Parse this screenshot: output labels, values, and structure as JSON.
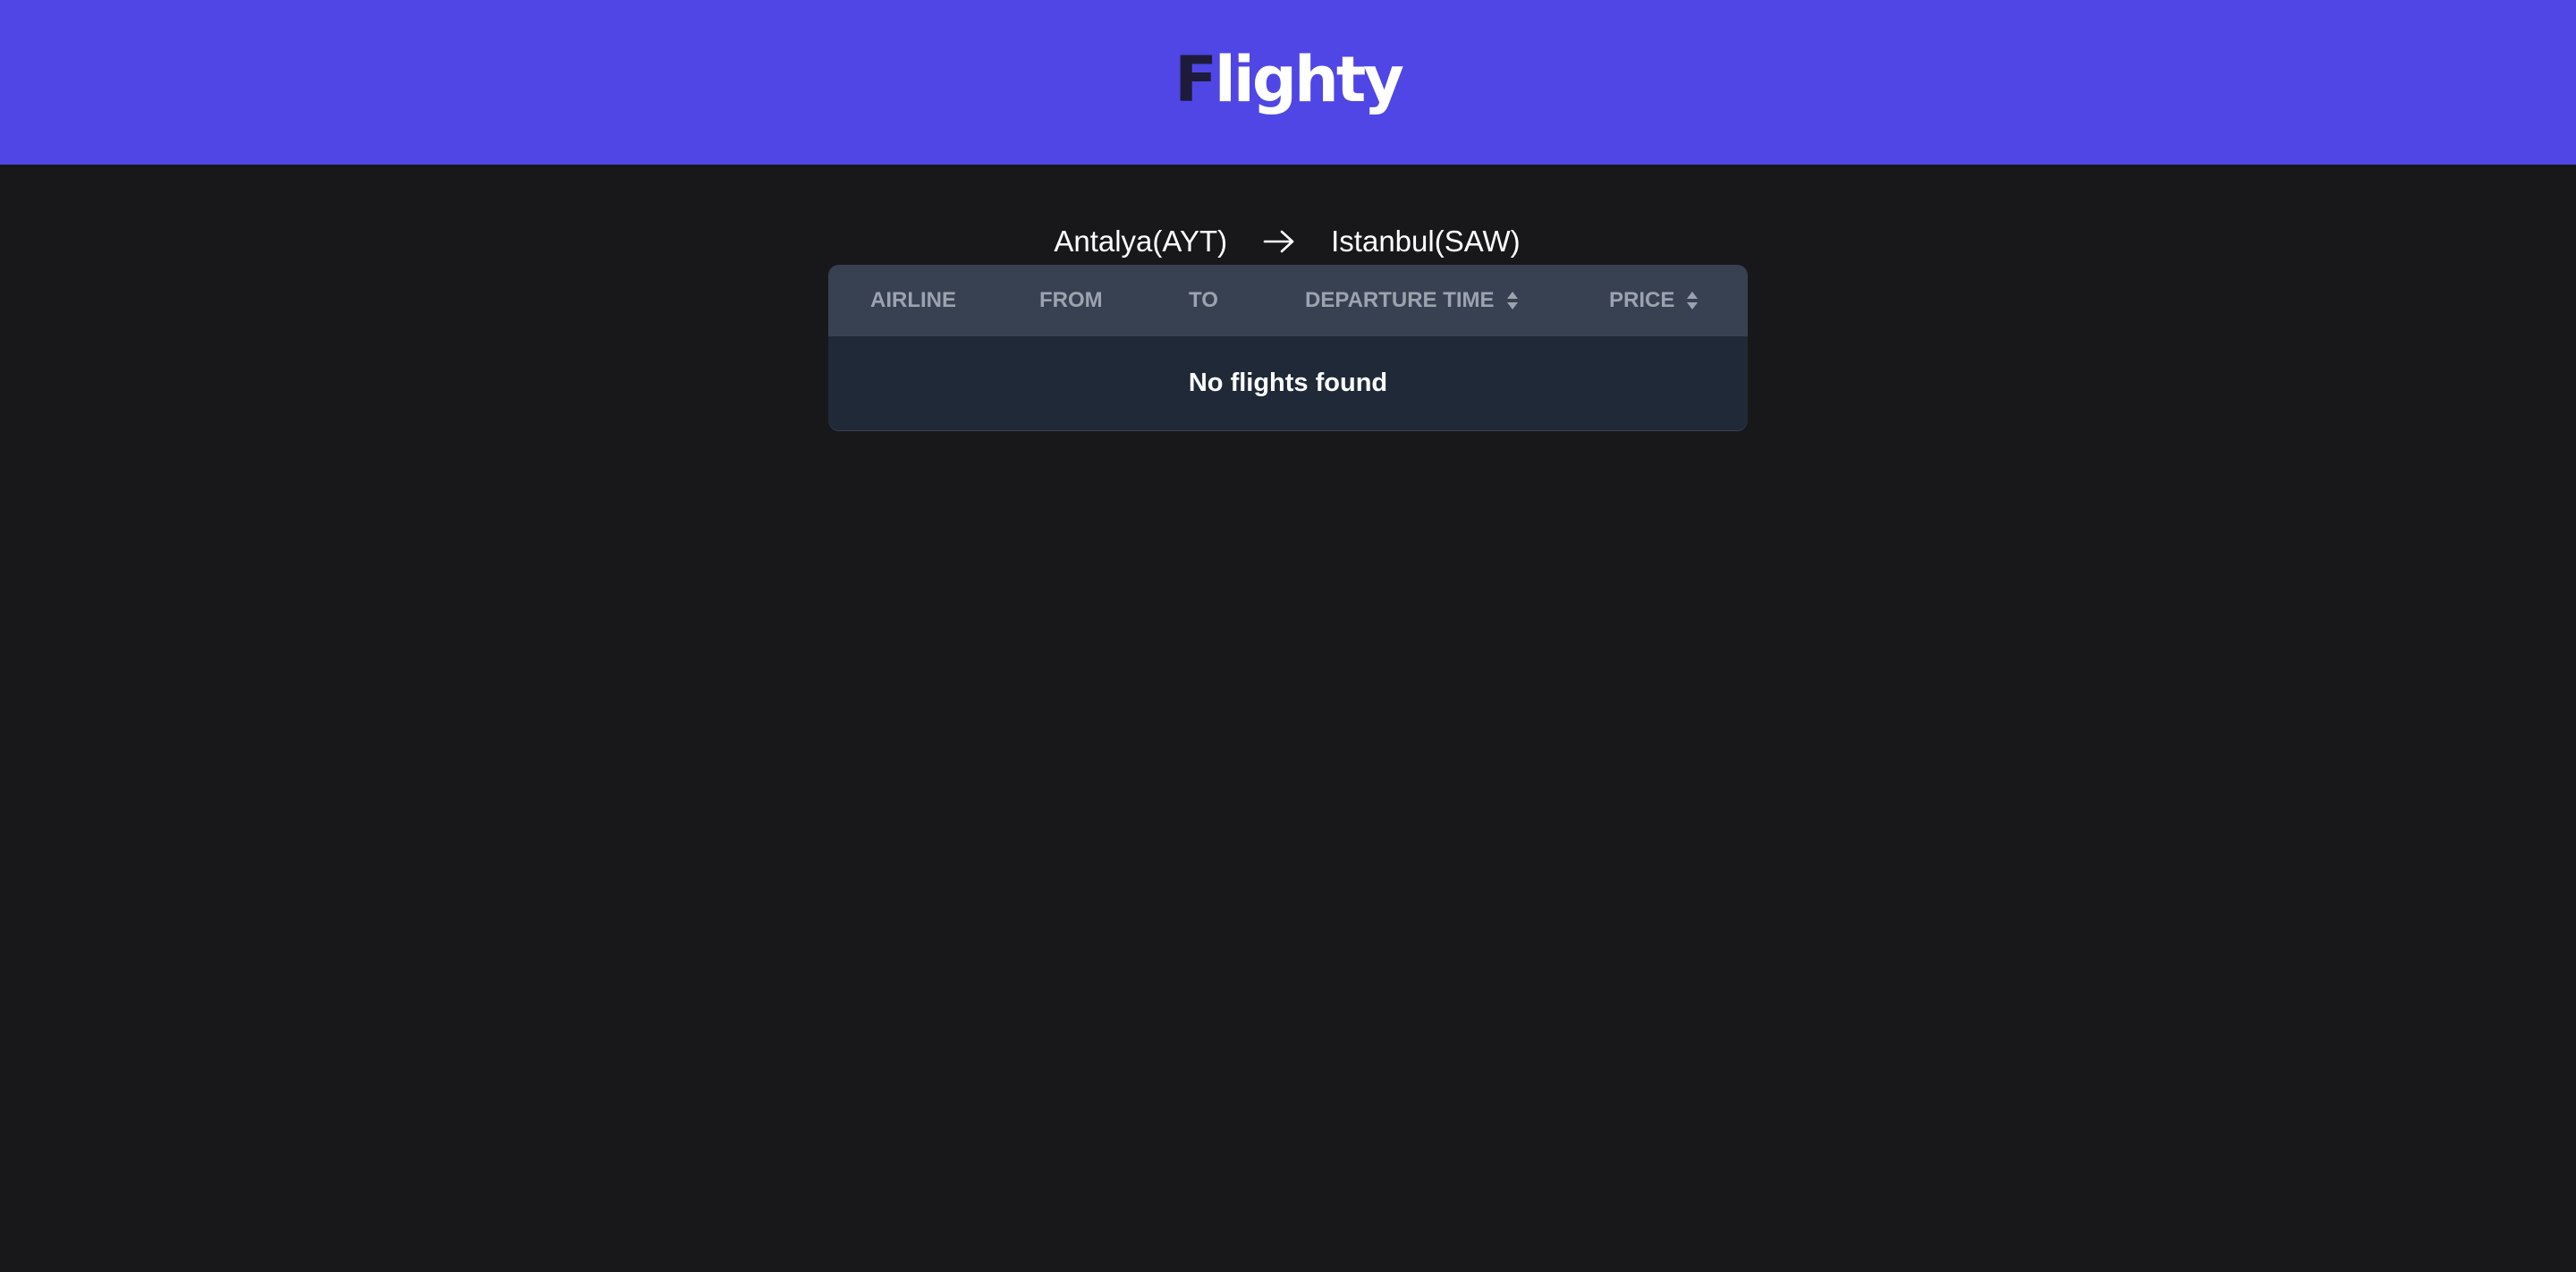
{
  "header": {
    "logo_first": "F",
    "logo_rest": "lighty",
    "background": "#4f46e5"
  },
  "route": {
    "from": "Antalya(AYT)",
    "to": "Istanbul(SAW)",
    "arrow_icon": "arrow-right-icon"
  },
  "table": {
    "columns": {
      "airline": "AIRLINE",
      "from": "FROM",
      "to": "TO",
      "departure_time": "DEPARTURE TIME",
      "price": "PRICE"
    },
    "empty_message": "No flights found"
  }
}
